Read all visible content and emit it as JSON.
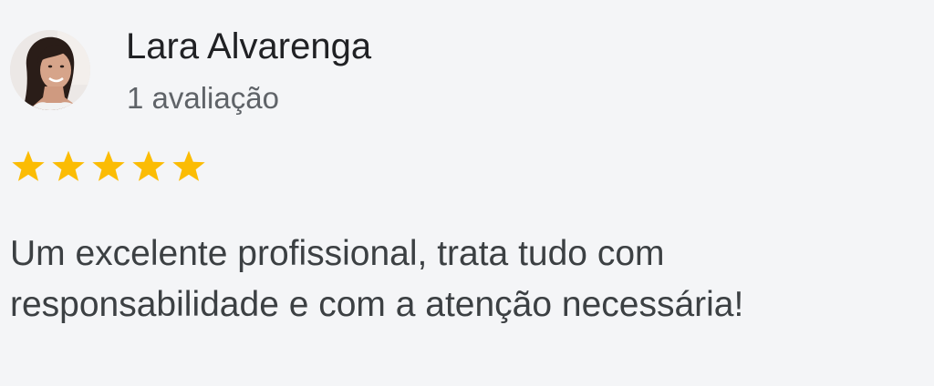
{
  "reviewer": {
    "name": "Lara Alvarenga",
    "review_count_label": "1 avaliação"
  },
  "rating": {
    "stars": 5,
    "max_stars": 5,
    "star_color": "#fbbc04"
  },
  "review": {
    "text": "Um excelente profissional, trata tudo com responsabilidade e com a atenção necessária!"
  },
  "icons": {
    "avatar": "user-photo",
    "star": "star-icon"
  }
}
